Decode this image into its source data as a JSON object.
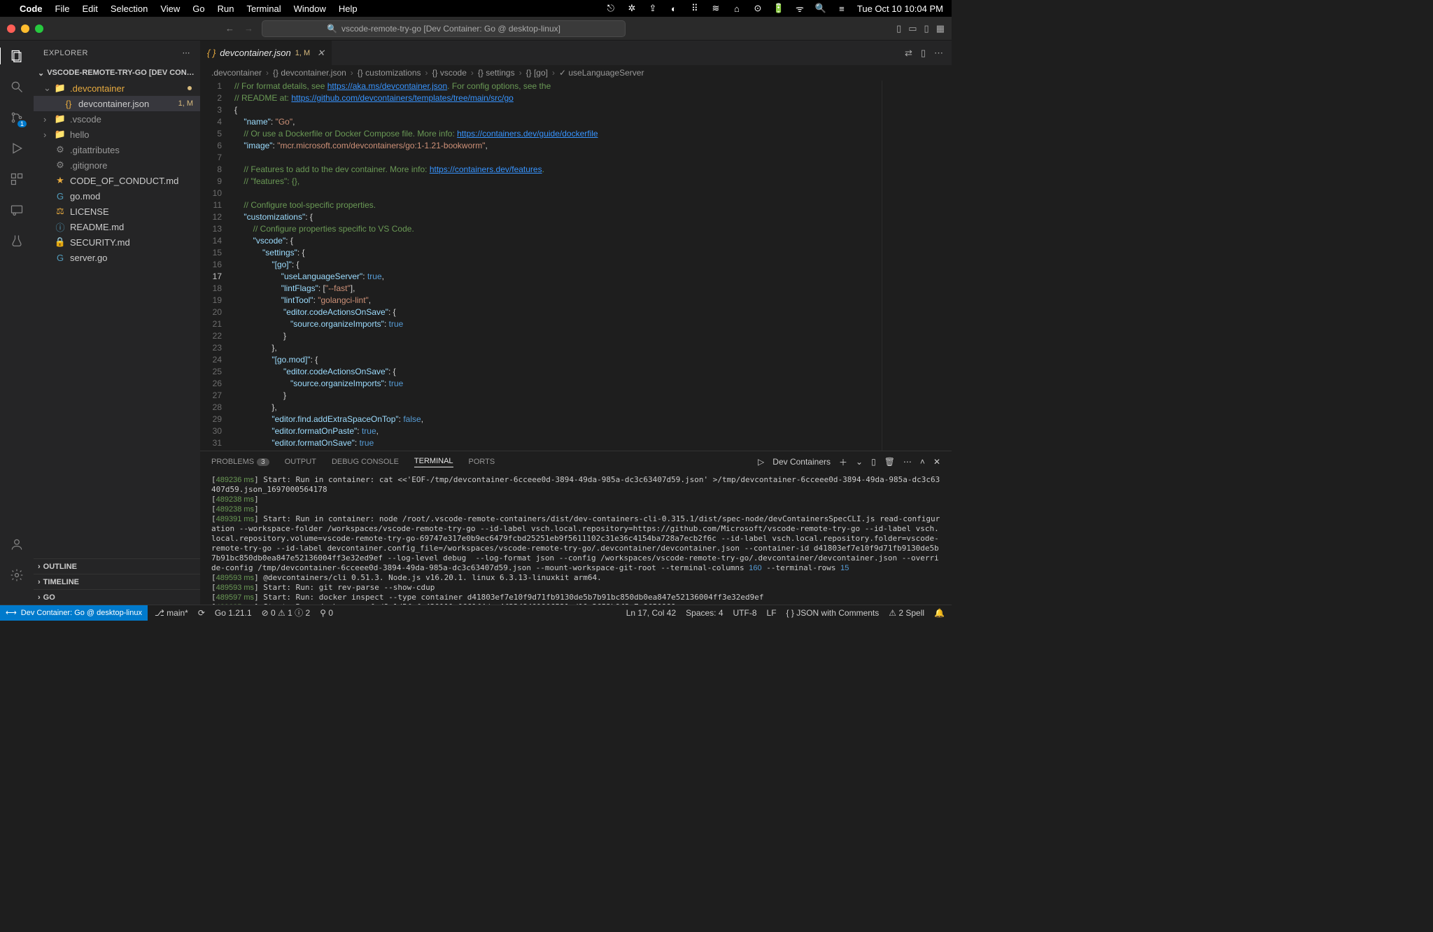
{
  "menubar": {
    "app": "Code",
    "items": [
      "File",
      "Edit",
      "Selection",
      "View",
      "Go",
      "Run",
      "Terminal",
      "Window",
      "Help"
    ],
    "datetime": "Tue Oct 10  10:04 PM"
  },
  "titlebar": {
    "command_center": "vscode-remote-try-go [Dev Container: Go @ desktop-linux]"
  },
  "sidebar": {
    "title": "EXPLORER",
    "workspace": "VSCODE-REMOTE-TRY-GO [DEV CONTA...",
    "tree": [
      {
        "type": "folder",
        "name": ".devcontainer",
        "open": true,
        "mod": true,
        "color": "#e8ab3f"
      },
      {
        "type": "file",
        "name": "devcontainer.json",
        "indent": 1,
        "mod": "1, M",
        "selected": true,
        "icon": "{}",
        "iconcolor": "#e8ab3f"
      },
      {
        "type": "folder",
        "name": ".vscode",
        "open": false,
        "mod": false,
        "dim": true
      },
      {
        "type": "folder",
        "name": "hello",
        "open": false,
        "mod": false,
        "dim": true
      },
      {
        "type": "file",
        "name": ".gitattributes",
        "dim": true,
        "icon": "⚙"
      },
      {
        "type": "file",
        "name": ".gitignore",
        "dim": true,
        "icon": "⚙"
      },
      {
        "type": "file",
        "name": "CODE_OF_CONDUCT.md",
        "icon": "★",
        "iconcolor": "#e8ab3f"
      },
      {
        "type": "file",
        "name": "go.mod",
        "icon": "G",
        "iconcolor": "#519aba"
      },
      {
        "type": "file",
        "name": "LICENSE",
        "icon": "⚖",
        "iconcolor": "#e8ab3f"
      },
      {
        "type": "file",
        "name": "README.md",
        "icon": "ⓘ",
        "iconcolor": "#519aba"
      },
      {
        "type": "file",
        "name": "SECURITY.md",
        "icon": "🔒",
        "iconcolor": "#e8ab3f"
      },
      {
        "type": "file",
        "name": "server.go",
        "icon": "G",
        "iconcolor": "#519aba"
      }
    ],
    "bottom_sections": [
      "OUTLINE",
      "TIMELINE",
      "GO"
    ]
  },
  "editor": {
    "tab": {
      "icon": "{}",
      "name": "devcontainer.json",
      "mod": "1, M"
    },
    "breadcrumbs": [
      ".devcontainer",
      "{} devcontainer.json",
      "{} customizations",
      "{} vscode",
      "{} settings",
      "{} [go]",
      "✓ useLanguageServer"
    ]
  },
  "panel": {
    "tabs": {
      "problems": "PROBLEMS",
      "problems_badge": "3",
      "output": "OUTPUT",
      "debug": "DEBUG CONSOLE",
      "terminal": "TERMINAL",
      "ports": "PORTS"
    },
    "task_label": "Dev Containers"
  },
  "statusbar": {
    "remote": "Dev Container: Go @ desktop-linux",
    "branch": "main*",
    "go": "Go 1.21.1",
    "errors": "0",
    "warnings": "1",
    "info": "2",
    "ports": "0",
    "cursor": "Ln 17, Col 42",
    "spaces": "Spaces: 4",
    "encoding": "UTF-8",
    "eol": "LF",
    "lang": "JSON with Comments",
    "spell": "2 Spell"
  }
}
